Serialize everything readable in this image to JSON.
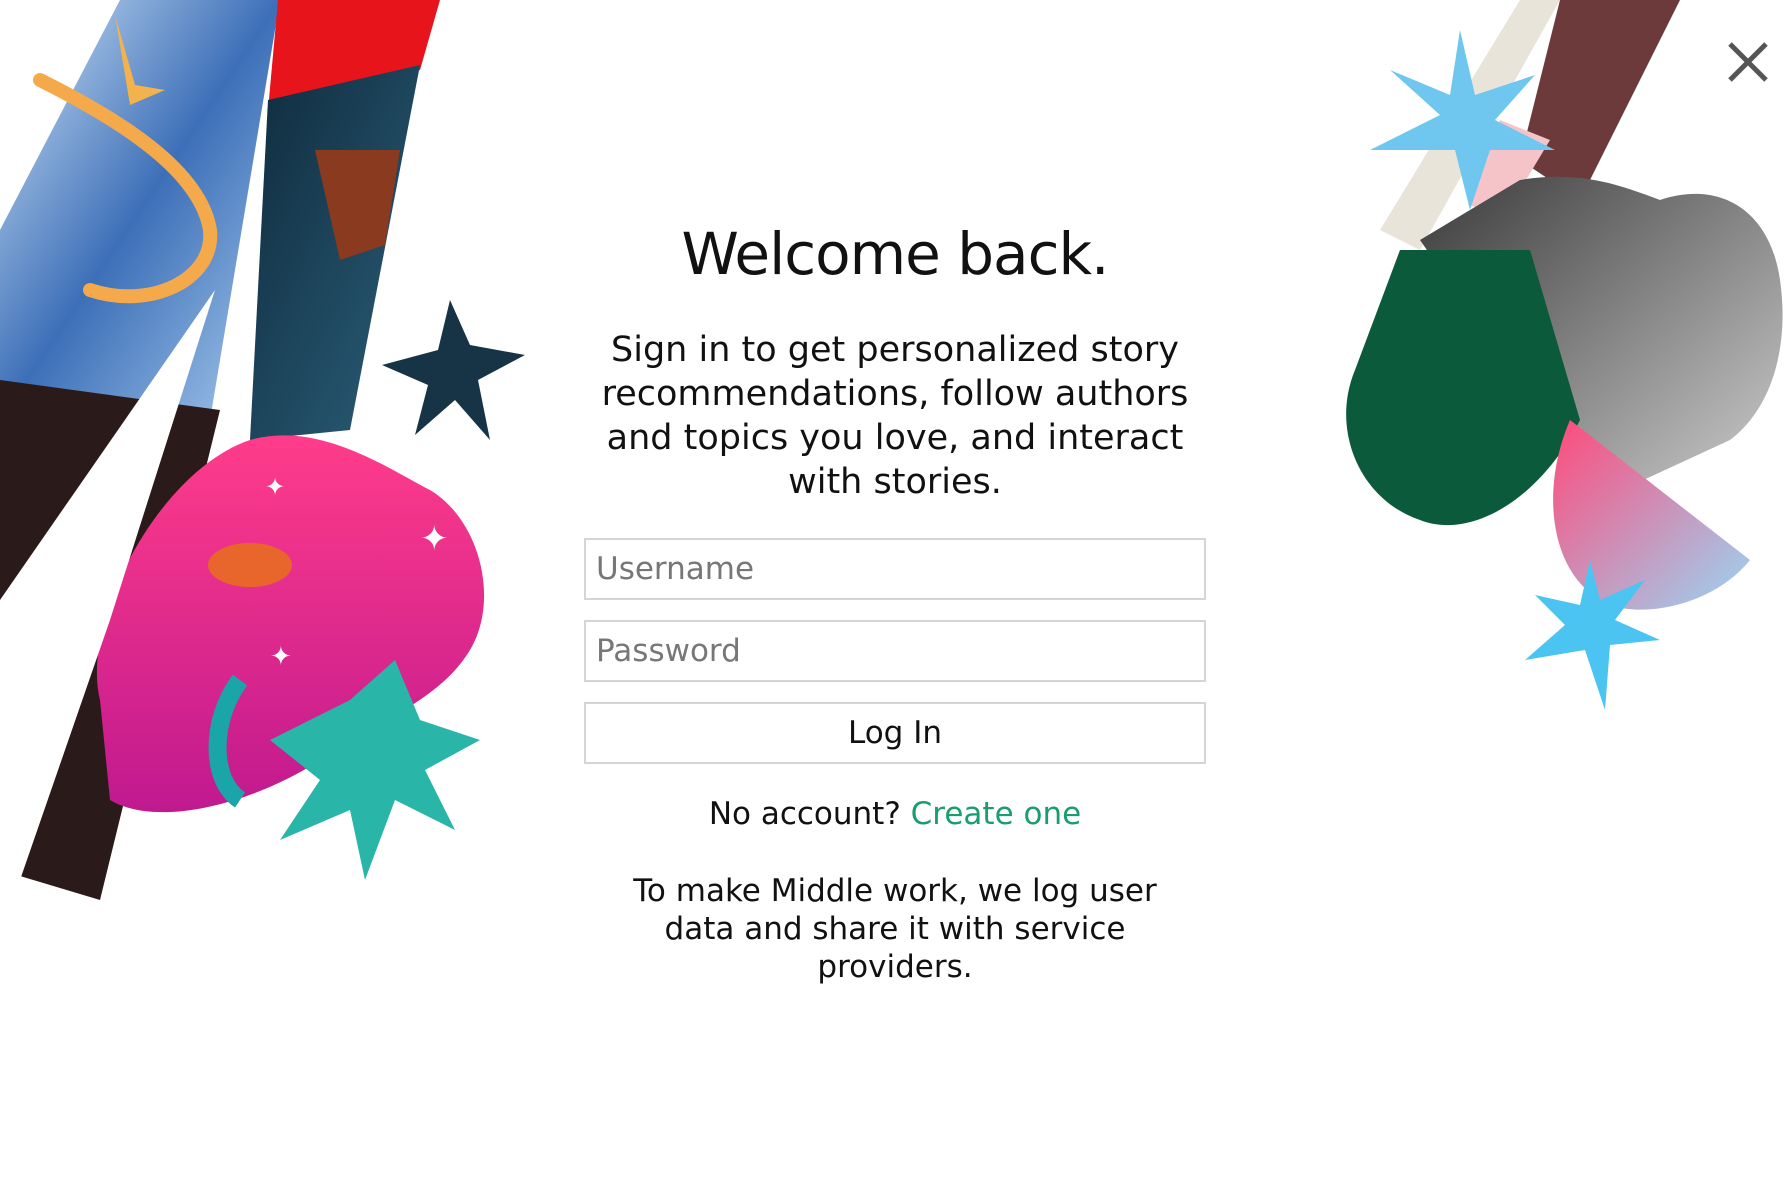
{
  "dialog": {
    "title": "Welcome back.",
    "subtitle": "Sign in to get personalized story recommendations, follow authors and topics you love, and interact with stories.",
    "close_icon": "close-icon"
  },
  "form": {
    "username_placeholder": "Username",
    "username_value": "",
    "password_placeholder": "Password",
    "password_value": "",
    "login_label": "Log In"
  },
  "signup": {
    "prompt": "No account?",
    "link_label": "Create one"
  },
  "notice": {
    "text": "To make Middle work, we log user data and share it with service providers."
  },
  "colors": {
    "link": "#1a9e6e",
    "border": "#d5d5d5",
    "accent_pink": "#f0287a",
    "accent_blue": "#5fc8f0",
    "accent_green": "#0b5a3c"
  }
}
